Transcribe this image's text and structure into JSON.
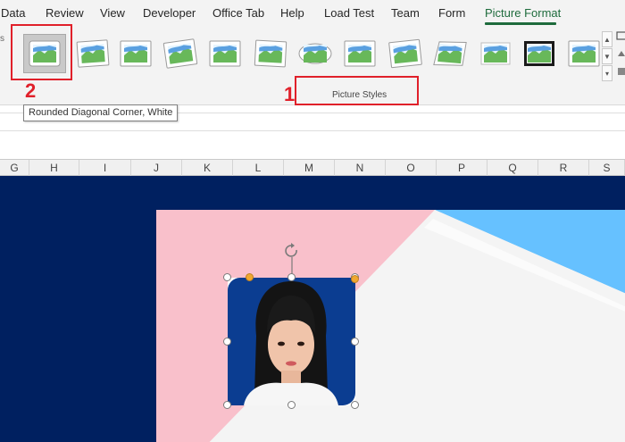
{
  "ribbon": {
    "tabs": [
      {
        "label": "Data"
      },
      {
        "label": "Review"
      },
      {
        "label": "View"
      },
      {
        "label": "Developer"
      },
      {
        "label": "Office Tab"
      },
      {
        "label": "Help"
      },
      {
        "label": "Load Test"
      },
      {
        "label": "Team"
      },
      {
        "label": "Form"
      },
      {
        "label": "Picture Format",
        "active": true
      }
    ],
    "group_label": "Picture Styles",
    "left_edge_text": "s",
    "styles": [
      {
        "name": "Rounded Diagonal Corner, White",
        "selected": true
      },
      {
        "name": "style-2"
      },
      {
        "name": "style-3"
      },
      {
        "name": "style-4"
      },
      {
        "name": "style-5"
      },
      {
        "name": "style-6"
      },
      {
        "name": "style-7"
      },
      {
        "name": "style-8"
      },
      {
        "name": "style-9"
      },
      {
        "name": "style-10"
      },
      {
        "name": "style-11"
      },
      {
        "name": "style-12"
      },
      {
        "name": "style-13"
      }
    ]
  },
  "tooltip": {
    "text": "Rounded Diagonal Corner, White"
  },
  "annotations": {
    "num1": "1",
    "num2": "2"
  },
  "columns": [
    "G",
    "H",
    "I",
    "J",
    "K",
    "L",
    "M",
    "N",
    "O",
    "P",
    "Q",
    "R",
    "S"
  ],
  "colors": {
    "accent": "#1e6b3c",
    "annotation": "#e0202a",
    "sheet_bg": "#002060",
    "pink": "#f9c0cb",
    "sky": "#66c1ff"
  }
}
